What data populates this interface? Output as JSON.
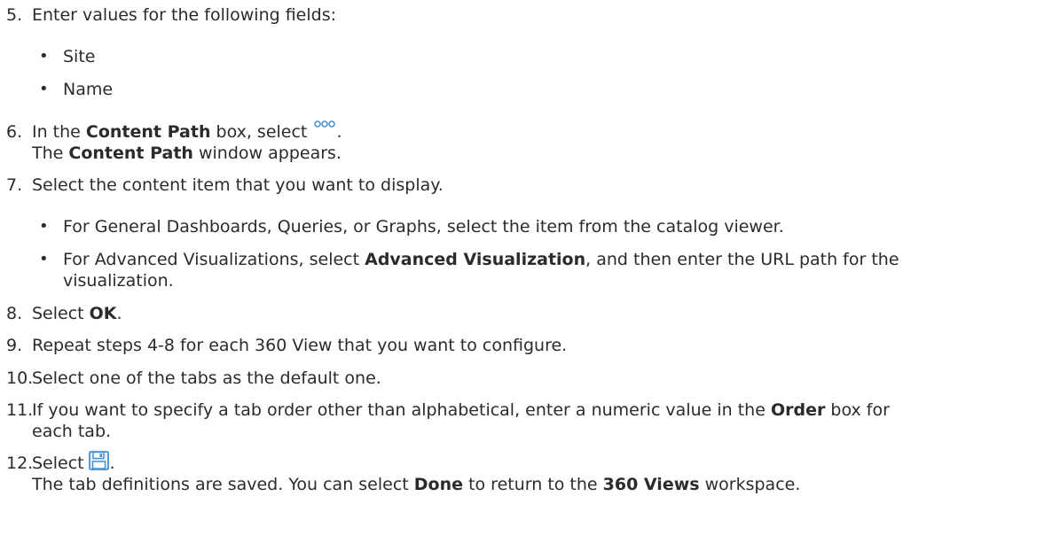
{
  "step5": {
    "num": "5.",
    "text": "Enter values for the following fields:",
    "fields": [
      "Site",
      "Name"
    ]
  },
  "step6": {
    "num": "6.",
    "pre": "In the ",
    "bold": "Content Path",
    "mid": " box, select ",
    "post": ".",
    "icon": "more-options-icon",
    "result_pre": "The ",
    "result_bold": "Content Path",
    "result_post": " window appears."
  },
  "step7": {
    "num": "7.",
    "text": "Select the content item that you want to display.",
    "bullet1": "For General Dashboards, Queries, or Graphs, select the item from the catalog viewer.",
    "bullet2_pre": "For Advanced Visualizations, select ",
    "bullet2_bold": "Advanced Visualization",
    "bullet2_post": ", and then enter the URL path for the",
    "bullet2_cont": "visualization."
  },
  "step8": {
    "num": "8.",
    "pre": "Select ",
    "bold": "OK",
    "post": "."
  },
  "step9": {
    "num": "9.",
    "text": "Repeat steps 4-8 for each 360 View that you want to configure."
  },
  "step10": {
    "num": "10.",
    "text": "Select one of the tabs as the default one."
  },
  "step11": {
    "num": "11.",
    "pre": "If you want to specify a tab order other than alphabetical, enter a numeric value in the ",
    "bold": "Order",
    "post": " box for",
    "cont": "each tab."
  },
  "step12": {
    "num": "12.",
    "pre": "Select",
    "post": ".",
    "icon": "save-icon",
    "result_pre": "The tab definitions are saved. You can select ",
    "result_bold1": "Done",
    "result_mid": " to return to the ",
    "result_bold2": "360 Views",
    "result_post": " workspace."
  },
  "colors": {
    "text": "#2b2b2b",
    "icon_blue": "#4a8fd6"
  }
}
